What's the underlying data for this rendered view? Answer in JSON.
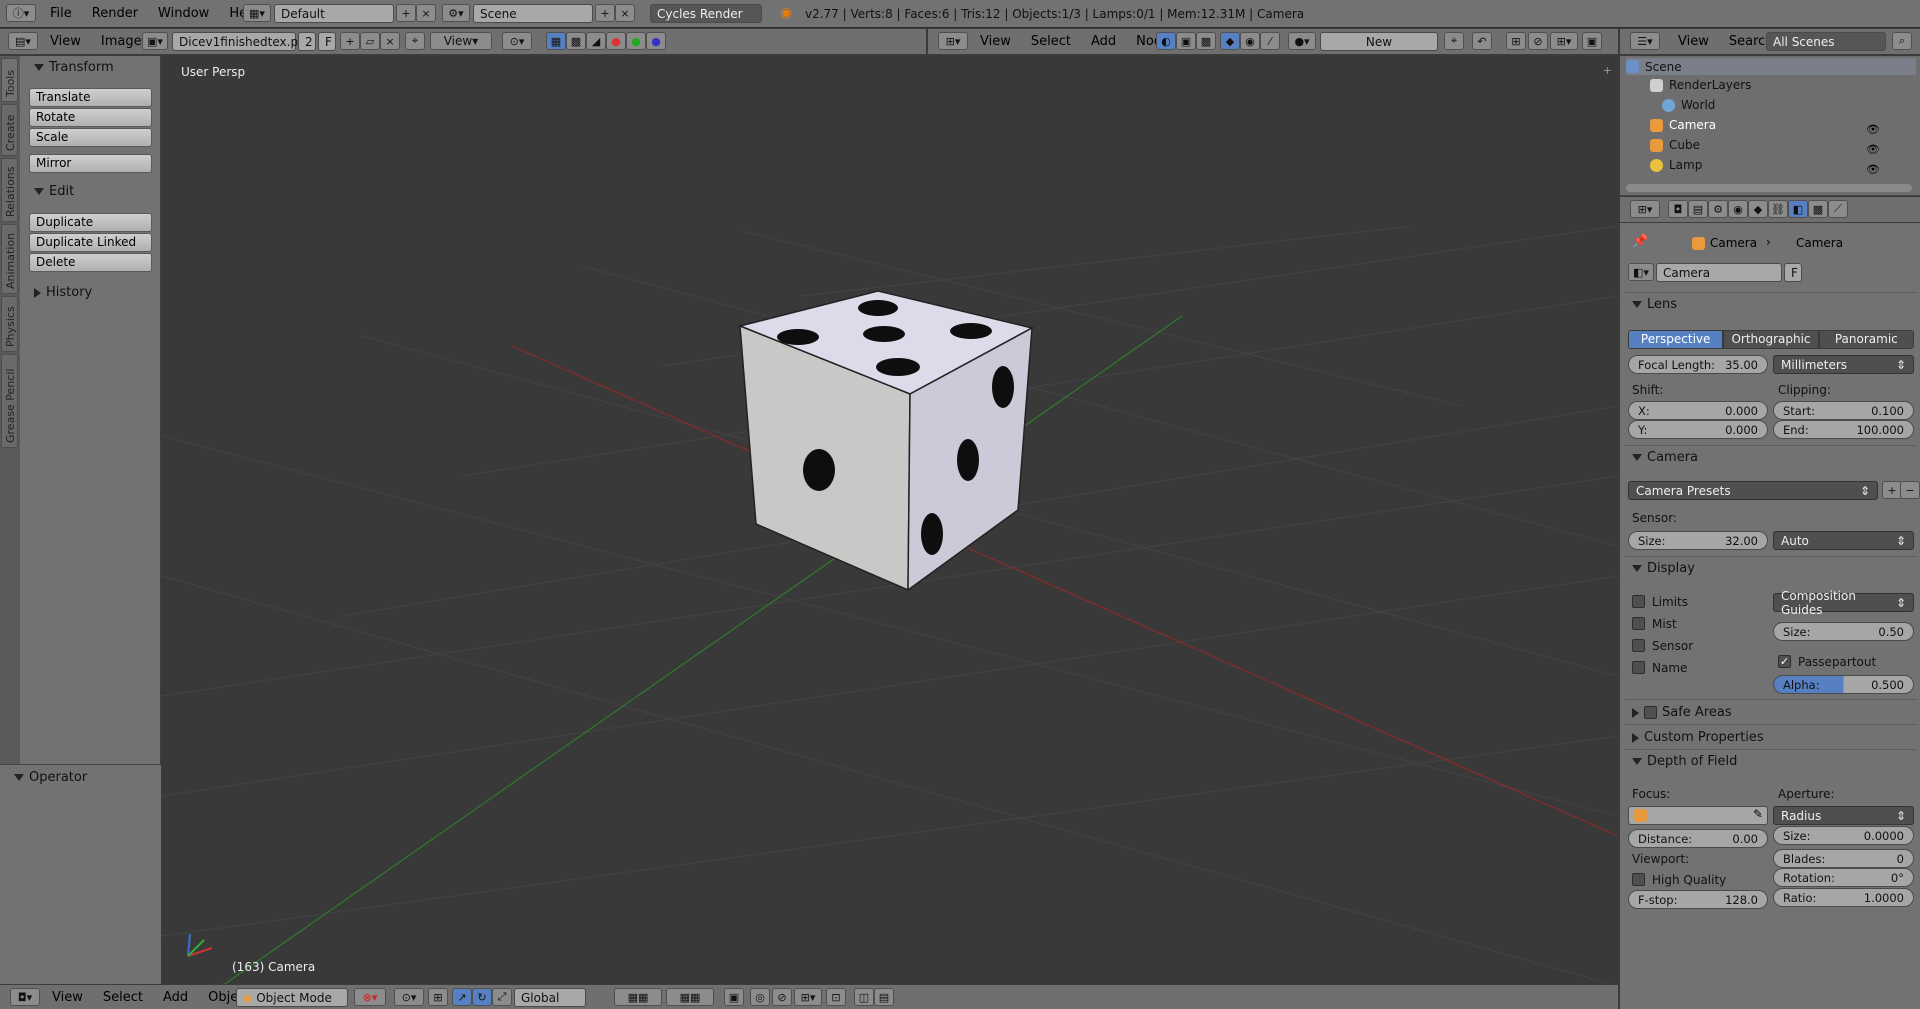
{
  "topbar": {
    "menus": [
      "File",
      "Render",
      "Window",
      "Help"
    ],
    "layout": "Default",
    "scene": "Scene",
    "engine": "Cycles Render",
    "stats": "v2.77 | Verts:8 | Faces:6 | Tris:12 | Objects:1/3 | Lamps:0/1 | Mem:12.31M | Camera"
  },
  "image_editor_header": {
    "menus": [
      "View",
      "Image"
    ],
    "image_name": "Dicev1finishedtex.p...",
    "users": "2",
    "fake": "F",
    "view_btn": "View"
  },
  "node_header": {
    "menus": [
      "View",
      "Select",
      "Add",
      "Node"
    ],
    "new_label": "New"
  },
  "outliner_header": {
    "menus": [
      "View",
      "Search"
    ],
    "filter": "All Scenes"
  },
  "outliner": {
    "items": [
      {
        "label": "Scene"
      },
      {
        "label": "RenderLayers"
      },
      {
        "label": "World"
      },
      {
        "label": "Camera"
      },
      {
        "label": "Cube"
      },
      {
        "label": "Lamp"
      }
    ]
  },
  "tool_tabs": [
    "Tools",
    "Create",
    "Relations",
    "Animation",
    "Physics",
    "Grease Pencil"
  ],
  "toolshelf": {
    "transform_title": "Transform",
    "transform_buttons": [
      "Translate",
      "Rotate",
      "Scale",
      "Mirror"
    ],
    "edit_title": "Edit",
    "edit_buttons": [
      "Duplicate",
      "Duplicate Linked",
      "Delete"
    ],
    "history_title": "History",
    "operator_title": "Operator"
  },
  "viewport": {
    "label": "User Persp",
    "object_label": "(163) Camera"
  },
  "properties": {
    "breadcrumb": [
      "Camera",
      "Camera"
    ],
    "data_name": "Camera",
    "fake": "F",
    "lens": {
      "title": "Lens",
      "tabs": [
        "Perspective",
        "Orthographic",
        "Panoramic"
      ],
      "focal_label": "Focal Length:",
      "focal_value": "35.00",
      "unit": "Millimeters",
      "shift_label": "Shift:",
      "clip_label": "Clipping:",
      "x_label": "X:",
      "x_value": "0.000",
      "y_label": "Y:",
      "y_value": "0.000",
      "start_label": "Start:",
      "start_value": "0.100",
      "end_label": "End:",
      "end_value": "100.000"
    },
    "camera": {
      "title": "Camera",
      "presets": "Camera Presets",
      "sensor_label": "Sensor:",
      "size_label": "Size:",
      "size_value": "32.00",
      "fit": "Auto"
    },
    "display": {
      "title": "Display",
      "checks": [
        "Limits",
        "Mist",
        "Sensor",
        "Name"
      ],
      "guides": "Composition Guides",
      "size_label": "Size:",
      "size_value": "0.50",
      "passepartout": "Passepartout",
      "alpha_label": "Alpha:",
      "alpha_value": "0.500"
    },
    "safe_areas": "Safe Areas",
    "custom_props": "Custom Properties",
    "dof": {
      "title": "Depth of Field",
      "focus_label": "Focus:",
      "aperture_label": "Aperture:",
      "aperture_type": "Radius",
      "distance_label": "Distance:",
      "distance_value": "0.00",
      "size_label": "Size:",
      "size_value": "0.0000",
      "blades_label": "Blades:",
      "blades_value": "0",
      "viewport_label": "Viewport:",
      "rotation_label": "Rotation:",
      "rotation_value": "0°",
      "hq_label": "High Quality",
      "ratio_label": "Ratio:",
      "ratio_value": "1.0000",
      "fstop_label": "F-stop:",
      "fstop_value": "128.0"
    }
  },
  "bottombar": {
    "menus": [
      "View",
      "Select",
      "Add",
      "Object"
    ],
    "mode": "Object Mode",
    "orientation": "Global"
  },
  "colors": {
    "accent": "#5680c2",
    "grid": "#3c3c3c",
    "x_axis": "#8a2a2a",
    "y_axis": "#2d7a2d"
  }
}
